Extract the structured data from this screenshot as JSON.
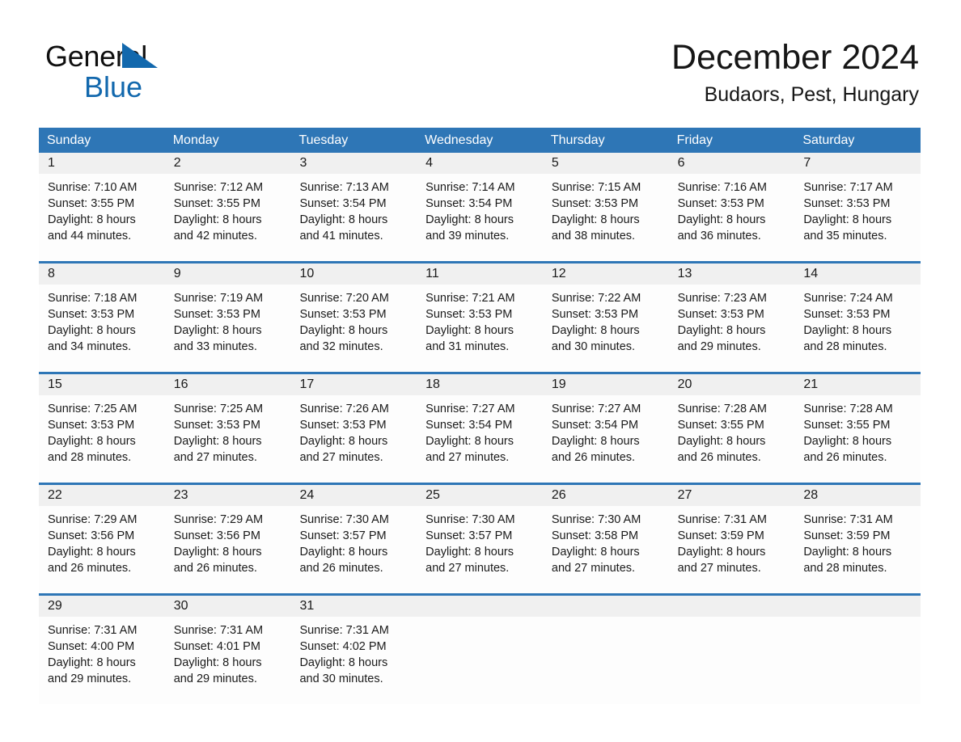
{
  "brand": {
    "name_part1": "General",
    "name_part2": "Blue",
    "triangle_color": "#1268ad"
  },
  "header": {
    "title": "December 2024",
    "subtitle": "Budaors, Pest, Hungary"
  },
  "theme": {
    "header_blue": "#2e76b6",
    "daynum_band": "#f0f0f0",
    "cell_bg": "#fdfdfd",
    "text": "#1a1a1a"
  },
  "weekdays": [
    "Sunday",
    "Monday",
    "Tuesday",
    "Wednesday",
    "Thursday",
    "Friday",
    "Saturday"
  ],
  "weeks": [
    {
      "days": [
        {
          "num": "1",
          "l1": "Sunrise: 7:10 AM",
          "l2": "Sunset: 3:55 PM",
          "l3": "Daylight: 8 hours",
          "l4": "and 44 minutes."
        },
        {
          "num": "2",
          "l1": "Sunrise: 7:12 AM",
          "l2": "Sunset: 3:55 PM",
          "l3": "Daylight: 8 hours",
          "l4": "and 42 minutes."
        },
        {
          "num": "3",
          "l1": "Sunrise: 7:13 AM",
          "l2": "Sunset: 3:54 PM",
          "l3": "Daylight: 8 hours",
          "l4": "and 41 minutes."
        },
        {
          "num": "4",
          "l1": "Sunrise: 7:14 AM",
          "l2": "Sunset: 3:54 PM",
          "l3": "Daylight: 8 hours",
          "l4": "and 39 minutes."
        },
        {
          "num": "5",
          "l1": "Sunrise: 7:15 AM",
          "l2": "Sunset: 3:53 PM",
          "l3": "Daylight: 8 hours",
          "l4": "and 38 minutes."
        },
        {
          "num": "6",
          "l1": "Sunrise: 7:16 AM",
          "l2": "Sunset: 3:53 PM",
          "l3": "Daylight: 8 hours",
          "l4": "and 36 minutes."
        },
        {
          "num": "7",
          "l1": "Sunrise: 7:17 AM",
          "l2": "Sunset: 3:53 PM",
          "l3": "Daylight: 8 hours",
          "l4": "and 35 minutes."
        }
      ]
    },
    {
      "days": [
        {
          "num": "8",
          "l1": "Sunrise: 7:18 AM",
          "l2": "Sunset: 3:53 PM",
          "l3": "Daylight: 8 hours",
          "l4": "and 34 minutes."
        },
        {
          "num": "9",
          "l1": "Sunrise: 7:19 AM",
          "l2": "Sunset: 3:53 PM",
          "l3": "Daylight: 8 hours",
          "l4": "and 33 minutes."
        },
        {
          "num": "10",
          "l1": "Sunrise: 7:20 AM",
          "l2": "Sunset: 3:53 PM",
          "l3": "Daylight: 8 hours",
          "l4": "and 32 minutes."
        },
        {
          "num": "11",
          "l1": "Sunrise: 7:21 AM",
          "l2": "Sunset: 3:53 PM",
          "l3": "Daylight: 8 hours",
          "l4": "and 31 minutes."
        },
        {
          "num": "12",
          "l1": "Sunrise: 7:22 AM",
          "l2": "Sunset: 3:53 PM",
          "l3": "Daylight: 8 hours",
          "l4": "and 30 minutes."
        },
        {
          "num": "13",
          "l1": "Sunrise: 7:23 AM",
          "l2": "Sunset: 3:53 PM",
          "l3": "Daylight: 8 hours",
          "l4": "and 29 minutes."
        },
        {
          "num": "14",
          "l1": "Sunrise: 7:24 AM",
          "l2": "Sunset: 3:53 PM",
          "l3": "Daylight: 8 hours",
          "l4": "and 28 minutes."
        }
      ]
    },
    {
      "days": [
        {
          "num": "15",
          "l1": "Sunrise: 7:25 AM",
          "l2": "Sunset: 3:53 PM",
          "l3": "Daylight: 8 hours",
          "l4": "and 28 minutes."
        },
        {
          "num": "16",
          "l1": "Sunrise: 7:25 AM",
          "l2": "Sunset: 3:53 PM",
          "l3": "Daylight: 8 hours",
          "l4": "and 27 minutes."
        },
        {
          "num": "17",
          "l1": "Sunrise: 7:26 AM",
          "l2": "Sunset: 3:53 PM",
          "l3": "Daylight: 8 hours",
          "l4": "and 27 minutes."
        },
        {
          "num": "18",
          "l1": "Sunrise: 7:27 AM",
          "l2": "Sunset: 3:54 PM",
          "l3": "Daylight: 8 hours",
          "l4": "and 27 minutes."
        },
        {
          "num": "19",
          "l1": "Sunrise: 7:27 AM",
          "l2": "Sunset: 3:54 PM",
          "l3": "Daylight: 8 hours",
          "l4": "and 26 minutes."
        },
        {
          "num": "20",
          "l1": "Sunrise: 7:28 AM",
          "l2": "Sunset: 3:55 PM",
          "l3": "Daylight: 8 hours",
          "l4": "and 26 minutes."
        },
        {
          "num": "21",
          "l1": "Sunrise: 7:28 AM",
          "l2": "Sunset: 3:55 PM",
          "l3": "Daylight: 8 hours",
          "l4": "and 26 minutes."
        }
      ]
    },
    {
      "days": [
        {
          "num": "22",
          "l1": "Sunrise: 7:29 AM",
          "l2": "Sunset: 3:56 PM",
          "l3": "Daylight: 8 hours",
          "l4": "and 26 minutes."
        },
        {
          "num": "23",
          "l1": "Sunrise: 7:29 AM",
          "l2": "Sunset: 3:56 PM",
          "l3": "Daylight: 8 hours",
          "l4": "and 26 minutes."
        },
        {
          "num": "24",
          "l1": "Sunrise: 7:30 AM",
          "l2": "Sunset: 3:57 PM",
          "l3": "Daylight: 8 hours",
          "l4": "and 26 minutes."
        },
        {
          "num": "25",
          "l1": "Sunrise: 7:30 AM",
          "l2": "Sunset: 3:57 PM",
          "l3": "Daylight: 8 hours",
          "l4": "and 27 minutes."
        },
        {
          "num": "26",
          "l1": "Sunrise: 7:30 AM",
          "l2": "Sunset: 3:58 PM",
          "l3": "Daylight: 8 hours",
          "l4": "and 27 minutes."
        },
        {
          "num": "27",
          "l1": "Sunrise: 7:31 AM",
          "l2": "Sunset: 3:59 PM",
          "l3": "Daylight: 8 hours",
          "l4": "and 27 minutes."
        },
        {
          "num": "28",
          "l1": "Sunrise: 7:31 AM",
          "l2": "Sunset: 3:59 PM",
          "l3": "Daylight: 8 hours",
          "l4": "and 28 minutes."
        }
      ]
    },
    {
      "days": [
        {
          "num": "29",
          "l1": "Sunrise: 7:31 AM",
          "l2": "Sunset: 4:00 PM",
          "l3": "Daylight: 8 hours",
          "l4": "and 29 minutes."
        },
        {
          "num": "30",
          "l1": "Sunrise: 7:31 AM",
          "l2": "Sunset: 4:01 PM",
          "l3": "Daylight: 8 hours",
          "l4": "and 29 minutes."
        },
        {
          "num": "31",
          "l1": "Sunrise: 7:31 AM",
          "l2": "Sunset: 4:02 PM",
          "l3": "Daylight: 8 hours",
          "l4": "and 30 minutes."
        },
        {
          "num": "",
          "l1": "",
          "l2": "",
          "l3": "",
          "l4": ""
        },
        {
          "num": "",
          "l1": "",
          "l2": "",
          "l3": "",
          "l4": ""
        },
        {
          "num": "",
          "l1": "",
          "l2": "",
          "l3": "",
          "l4": ""
        },
        {
          "num": "",
          "l1": "",
          "l2": "",
          "l3": "",
          "l4": ""
        }
      ]
    }
  ]
}
